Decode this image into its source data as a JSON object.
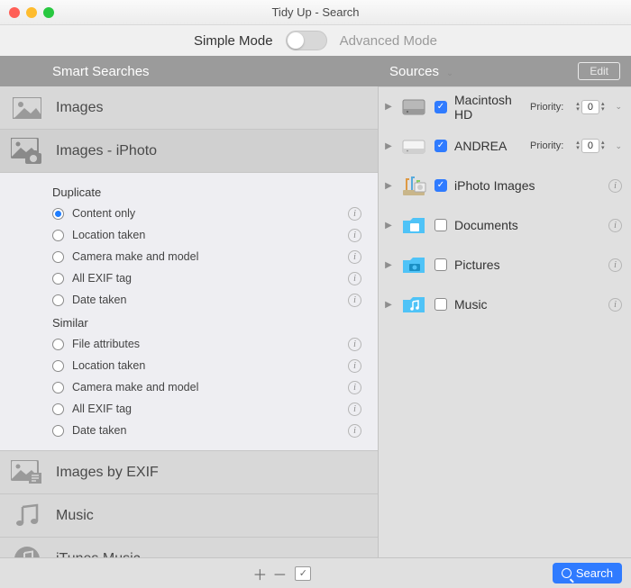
{
  "window": {
    "title": "Tidy Up - Search"
  },
  "mode": {
    "simple": "Simple Mode",
    "advanced": "Advanced Mode",
    "active": "simple"
  },
  "headers": {
    "smart": "Smart Searches",
    "sources": "Sources",
    "edit": "Edit"
  },
  "categories": [
    {
      "label": "Images"
    },
    {
      "label": "Images - iPhoto"
    },
    {
      "label": "Images by EXIF"
    },
    {
      "label": "Music"
    },
    {
      "label": "iTunes Music"
    }
  ],
  "options": {
    "dup_header": "Duplicate",
    "dup": [
      {
        "label": "Content only",
        "selected": true
      },
      {
        "label": "Location taken",
        "selected": false
      },
      {
        "label": "Camera make and model",
        "selected": false
      },
      {
        "label": "All EXIF tag",
        "selected": false
      },
      {
        "label": "Date taken",
        "selected": false
      }
    ],
    "sim_header": "Similar",
    "sim": [
      {
        "label": "File attributes",
        "selected": false
      },
      {
        "label": "Location taken",
        "selected": false
      },
      {
        "label": "Camera make and model",
        "selected": false
      },
      {
        "label": "All EXIF tag",
        "selected": false
      },
      {
        "label": "Date taken",
        "selected": false
      }
    ]
  },
  "sources": [
    {
      "name": "Macintosh HD",
      "checked": true,
      "priority_label": "Priority:",
      "priority": "0",
      "has_priority": true,
      "icon": "hdd"
    },
    {
      "name": "ANDREA",
      "checked": true,
      "priority_label": "Priority:",
      "priority": "0",
      "has_priority": true,
      "icon": "ext"
    },
    {
      "name": "iPhoto Images",
      "checked": true,
      "has_priority": false,
      "icon": "iphoto"
    },
    {
      "name": "Documents",
      "checked": false,
      "has_priority": false,
      "icon": "folder-docs"
    },
    {
      "name": "Pictures",
      "checked": false,
      "has_priority": false,
      "icon": "folder-pics"
    },
    {
      "name": "Music",
      "checked": false,
      "has_priority": false,
      "icon": "folder-music"
    }
  ],
  "footer": {
    "search": "Search"
  }
}
